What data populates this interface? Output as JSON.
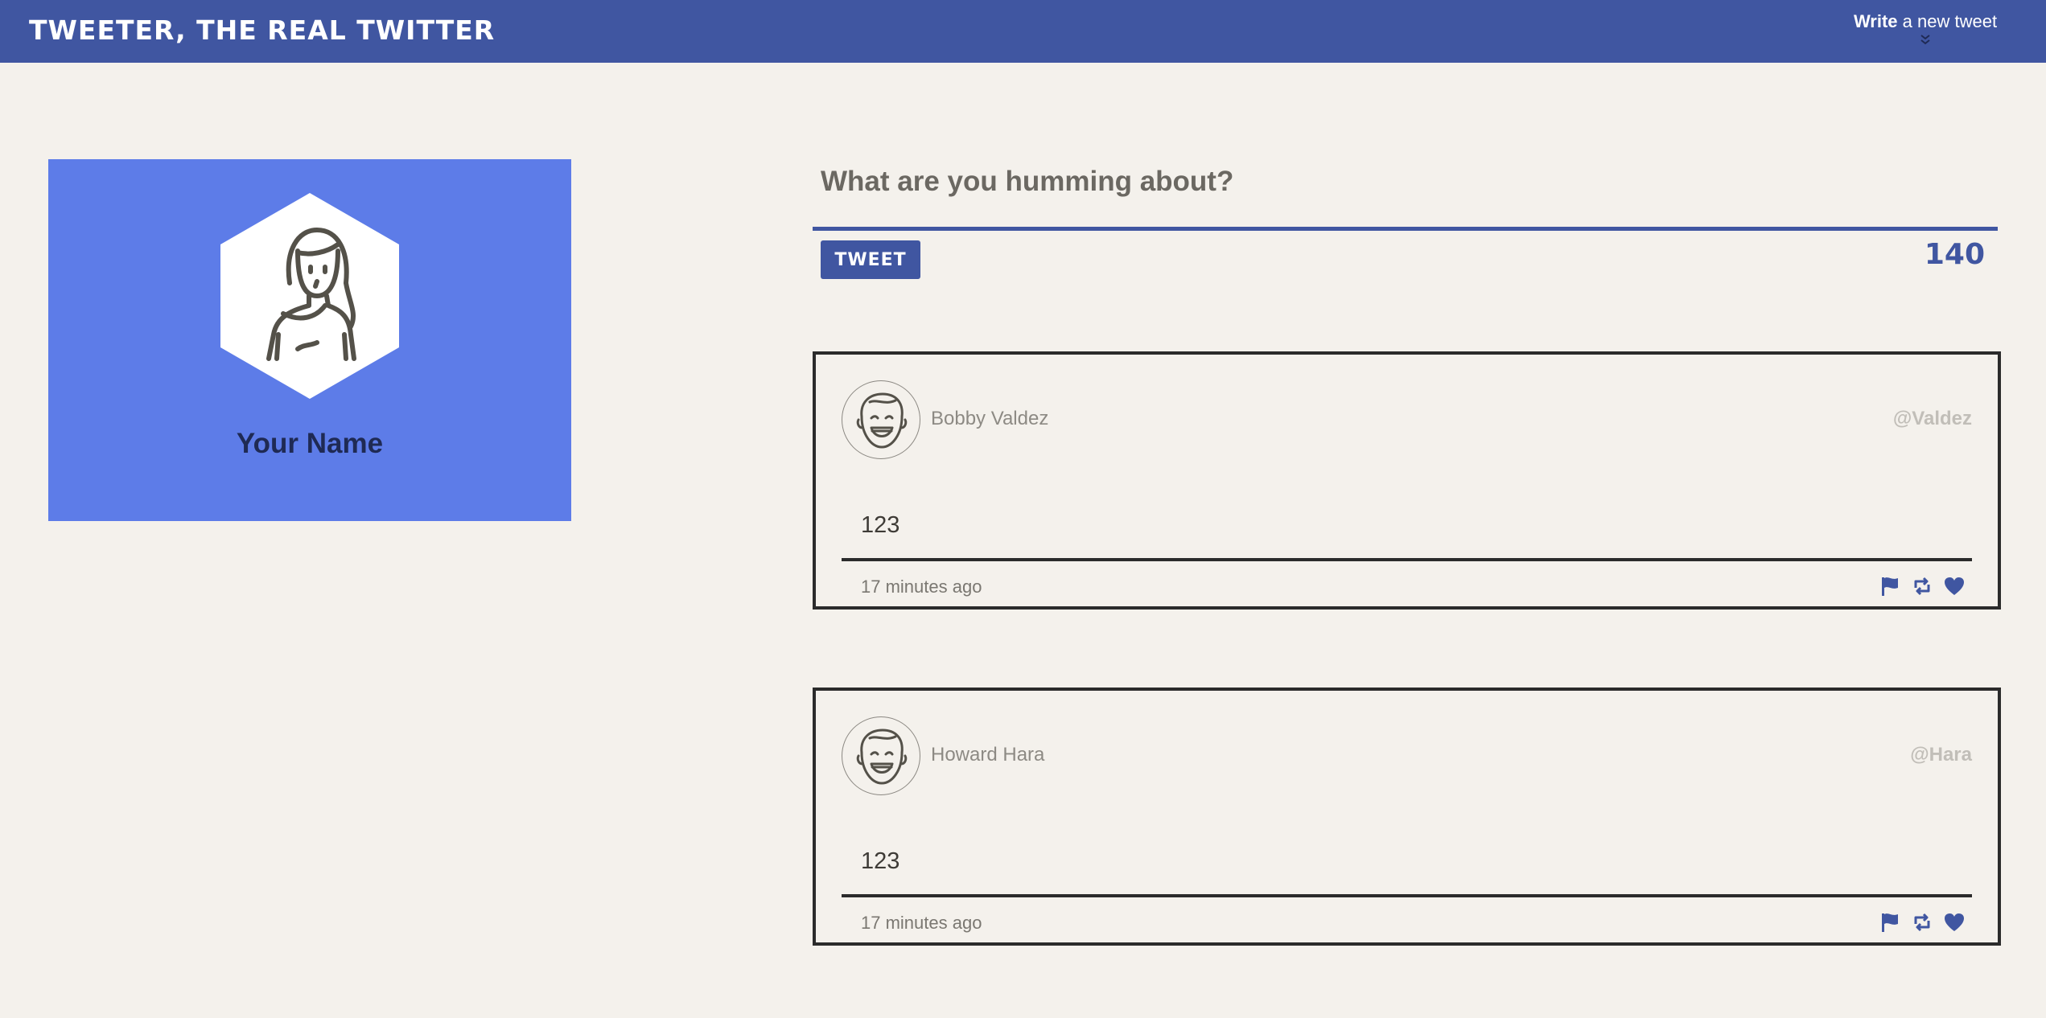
{
  "header": {
    "brand": "TWEETER, THE REAL TWITTER",
    "write_bold": "Write",
    "write_rest": " a new tweet"
  },
  "profile": {
    "name": "Your Name"
  },
  "compose": {
    "prompt": "What are you humming about?",
    "button_label": "TWEET",
    "counter": "140"
  },
  "tweets": [
    {
      "name": "Bobby Valdez",
      "handle": "@Valdez",
      "body": "123",
      "time": "17 minutes ago"
    },
    {
      "name": "Howard Hara",
      "handle": "@Hara",
      "body": "123",
      "time": "17 minutes ago"
    }
  ],
  "icons": {
    "flag": "flag-icon",
    "retweet": "retweet-icon",
    "like": "heart-icon"
  },
  "colors": {
    "accent": "#4056a1",
    "profile_bg": "#5d7ce8",
    "page_bg": "#f4f1ec"
  }
}
